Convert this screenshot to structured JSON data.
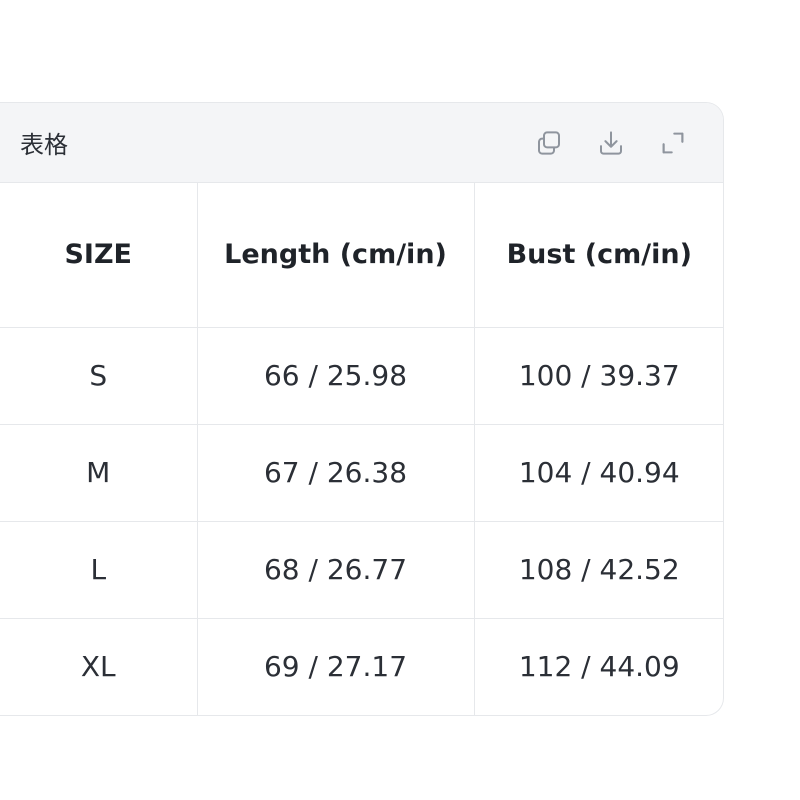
{
  "card": {
    "title": "表格",
    "tools": [
      {
        "name": "copy-icon",
        "label": "copy"
      },
      {
        "name": "download-icon",
        "label": "download"
      },
      {
        "name": "expand-icon",
        "label": "expand"
      }
    ]
  },
  "table": {
    "headers": [
      "SIZE",
      "Length (cm/in)",
      "Bust (cm/in)"
    ],
    "rows": [
      [
        "S",
        "66 / 25.98",
        "100 / 39.37"
      ],
      [
        "M",
        "67 / 26.38",
        "104 / 40.94"
      ],
      [
        "L",
        "68 / 26.77",
        "108 / 42.52"
      ],
      [
        "XL",
        "69 / 27.17",
        "112 / 44.09"
      ]
    ]
  },
  "colors": {
    "header_bg": "#f4f5f7",
    "border": "#e6e8eb",
    "icon": "#8f959e"
  }
}
